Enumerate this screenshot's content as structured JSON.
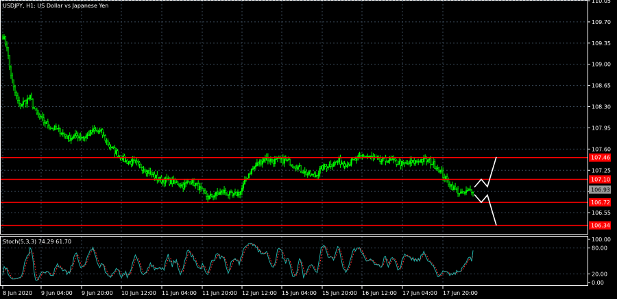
{
  "window": {
    "title": "USDJPY, H1:  US Dollar vs Japanese Yen"
  },
  "colors": {
    "background": "#000000",
    "grid": "#3a4a5a",
    "candle": "#00ff00",
    "level_line": "#ff0000",
    "level_tag": "#ff0000",
    "current_price_tag": "#9a9a9a",
    "stoch_main": "#20b2aa",
    "stoch_signal": "#ff3030",
    "arrow": "#ffffff"
  },
  "price_axis": {
    "min": 106.2,
    "max": 110.05,
    "ticks": [
      "110.05",
      "109.70",
      "109.35",
      "109.00",
      "108.65",
      "108.30",
      "107.95",
      "107.60",
      "107.25",
      "106.90",
      "106.55"
    ]
  },
  "levels": [
    {
      "value": 107.46,
      "label": "107.46"
    },
    {
      "value": 107.1,
      "label": "107.10"
    },
    {
      "value": 106.72,
      "label": "106.72"
    },
    {
      "value": 106.34,
      "label": "106.34"
    }
  ],
  "current_price": {
    "value": 106.93,
    "label": "106.93"
  },
  "oscillator": {
    "label": "Stoch(5,3,3) 74.29 61.70",
    "ticks": [
      "100.00",
      "80.00",
      "20.00",
      "0.00"
    ],
    "levels": [
      80,
      20
    ]
  },
  "time_axis": {
    "labels": [
      "8 Jun 2020",
      "9 Jun 04:00",
      "9 Jun 20:00",
      "10 Jun 12:00",
      "11 Jun 04:00",
      "11 Jun 20:00",
      "12 Jun 12:00",
      "15 Jun 04:00",
      "15 Jun 20:00",
      "16 Jun 12:00",
      "17 Jun 04:00",
      "17 Jun 20:00"
    ]
  },
  "forecast_arrows": {
    "up": [
      [
        0,
        106.97
      ],
      [
        1,
        107.1
      ],
      [
        2,
        106.98
      ],
      [
        3,
        107.47
      ]
    ],
    "down": [
      [
        0,
        106.85
      ],
      [
        1,
        106.72
      ],
      [
        2,
        106.84
      ],
      [
        3,
        106.34
      ]
    ]
  },
  "chart_data": {
    "type": "candlestick",
    "symbol": "USDJPY",
    "timeframe": "H1",
    "ylim": [
      106.2,
      110.05
    ],
    "close_anchors": [
      [
        0,
        109.47
      ],
      [
        3,
        109.3
      ],
      [
        5,
        108.95
      ],
      [
        8,
        108.6
      ],
      [
        12,
        108.32
      ],
      [
        16,
        108.38
      ],
      [
        20,
        108.45
      ],
      [
        24,
        108.2
      ],
      [
        30,
        108.05
      ],
      [
        36,
        107.95
      ],
      [
        42,
        107.9
      ],
      [
        48,
        107.78
      ],
      [
        54,
        107.82
      ],
      [
        60,
        107.8
      ],
      [
        66,
        107.9
      ],
      [
        72,
        107.88
      ],
      [
        78,
        107.65
      ],
      [
        84,
        107.52
      ],
      [
        90,
        107.4
      ],
      [
        96,
        107.38
      ],
      [
        102,
        107.3
      ],
      [
        108,
        107.2
      ],
      [
        114,
        107.1
      ],
      [
        120,
        107.08
      ],
      [
        126,
        107.05
      ],
      [
        132,
        107.0
      ],
      [
        138,
        107.08
      ],
      [
        144,
        106.95
      ],
      [
        150,
        106.8
      ],
      [
        156,
        106.85
      ],
      [
        162,
        106.9
      ],
      [
        168,
        106.82
      ],
      [
        174,
        106.9
      ],
      [
        180,
        107.2
      ],
      [
        186,
        107.35
      ],
      [
        192,
        107.45
      ],
      [
        198,
        107.4
      ],
      [
        204,
        107.42
      ],
      [
        210,
        107.38
      ],
      [
        216,
        107.3
      ],
      [
        222,
        107.2
      ],
      [
        228,
        107.15
      ],
      [
        234,
        107.3
      ],
      [
        240,
        107.35
      ],
      [
        246,
        107.4
      ],
      [
        252,
        107.35
      ],
      [
        258,
        107.42
      ],
      [
        264,
        107.5
      ],
      [
        270,
        107.46
      ],
      [
        276,
        107.4
      ],
      [
        282,
        107.42
      ],
      [
        288,
        107.38
      ],
      [
        294,
        107.35
      ],
      [
        300,
        107.38
      ],
      [
        306,
        107.42
      ],
      [
        312,
        107.4
      ],
      [
        318,
        107.3
      ],
      [
        324,
        107.1
      ],
      [
        330,
        106.95
      ],
      [
        336,
        106.85
      ],
      [
        340,
        106.9
      ],
      [
        344,
        106.93
      ]
    ],
    "stochastic": {
      "k_last": 74.29,
      "d_last": 61.7
    }
  }
}
